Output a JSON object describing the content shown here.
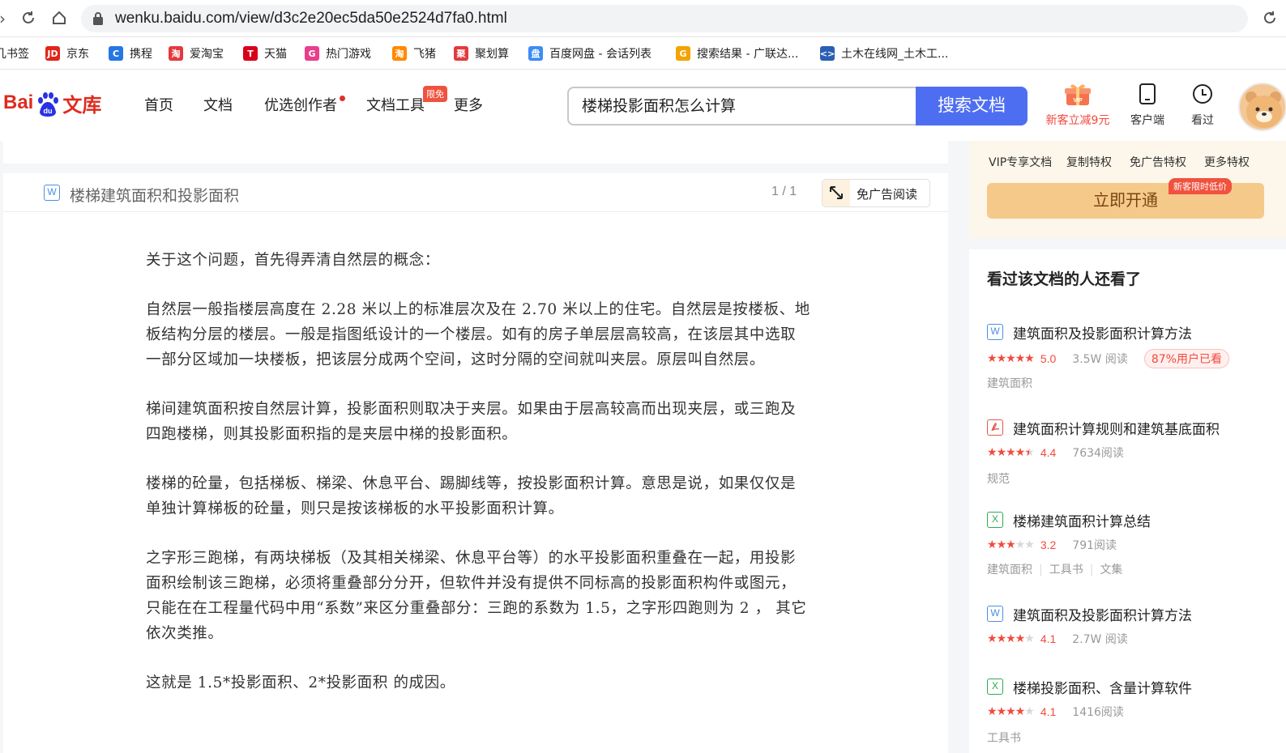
{
  "browser": {
    "url": "wenku.baidu.com/view/d3c2e20ec5da50e2524d7fa0.html"
  },
  "bookmarks": [
    {
      "label": "几书签",
      "icon": "bookmark-icon",
      "color": "#888888"
    },
    {
      "label": "京东",
      "icon": "jd-icon",
      "color": "#e1251b",
      "glyph": "JD"
    },
    {
      "label": "携程",
      "icon": "ctrip-icon",
      "color": "#2577e3",
      "glyph": "C"
    },
    {
      "label": "爱淘宝",
      "icon": "aitaobao-icon",
      "color": "#e4393c",
      "glyph": "淘"
    },
    {
      "label": "天猫",
      "icon": "tmall-icon",
      "color": "#d8001b",
      "glyph": "T"
    },
    {
      "label": "热门游戏",
      "icon": "games-icon",
      "color": "#e83e8c",
      "glyph": "G"
    },
    {
      "label": "飞猪",
      "icon": "fliggy-icon",
      "color": "#ff8a00",
      "glyph": "淘"
    },
    {
      "label": "聚划算",
      "icon": "juhuasuan-icon",
      "color": "#e4393c",
      "glyph": "聚"
    },
    {
      "label": "百度网盘 - 会话列表",
      "icon": "baidu-netdisk-icon",
      "color": "#3b8cf5",
      "glyph": "盘"
    },
    {
      "label": "搜索结果 - 广联达...",
      "icon": "glodon-icon",
      "color": "#f4a300",
      "glyph": "G"
    },
    {
      "label": "土木在线网_土木工...",
      "icon": "tumu-icon",
      "color": "#2b5fb4",
      "glyph": "<>"
    }
  ],
  "header": {
    "logo_bai": "Bai",
    "logo_du": "du",
    "logo_wenku": "文库",
    "nav": [
      "首页",
      "文档",
      "优选创作者",
      "文档工具",
      "更多"
    ],
    "limit_badge": "限免",
    "search_value": "楼梯投影面积怎么计算",
    "search_button": "搜索文档",
    "vip_promo": "新客立减9元",
    "client": "客户端",
    "history": "看过",
    "vip_gift_label": "VIP"
  },
  "document": {
    "title": "楼梯建筑面积和投影面积",
    "page_indicator": "1 / 1",
    "noad_label": "免广告阅读",
    "paragraphs": [
      "关于这个问题，首先得弄清自然层的概念：",
      "自然层一般指楼层高度在 2.28 米以上的标准层次及在 2.70 米以上的住宅。自然层是按楼板、地板结构分层的楼层。一般是指图纸设计的一个楼层。如有的房子单层层高较高，在该层其中选取一部分区域加一块楼板，把该层分成两个空间，这时分隔的空间就叫夹层。原层叫自然层。",
      "梯间建筑面积按自然层计算，投影面积则取决于夹层。如果由于层高较高而出现夹层，或三跑及四跑楼梯，则其投影面积指的是夹层中梯的投影面积。",
      "楼梯的砼量，包括梯板、梯梁、休息平台、踢脚线等，按投影面积计算。意思是说，如果仅仅是单独计算梯板的砼量，则只是按该梯板的水平投影面积计算。",
      "之字形三跑梯，有两块梯板（及其相关梯梁、休息平台等）的水平投影面积重叠在一起，用投影面积绘制该三跑梯，必须将重叠部分分开，但软件并没有提供不同标高的投影面积构件或图元，只能在在工程量代码中用“系数”来区分重叠部分：三跑的系数为 1.5，之字形四跑则为 2 ， 其它依次类推。",
      "这就是  1.5*投影面积、2*投影面积  的成因。"
    ]
  },
  "vip": {
    "perks": [
      "VIP专享文档",
      "复制特权",
      "免广告特权",
      "更多特权"
    ],
    "button": "立即开通",
    "badge": "新客限时低价"
  },
  "recommend": {
    "heading": "看过该文档的人还看了",
    "items": [
      {
        "type": "W",
        "color": "#4a90e2",
        "title": "建筑面积及投影面积计算方法",
        "stars": 5,
        "score": "5.0",
        "reads": "3.5W 阅读",
        "pct": "87%用户已看",
        "tags": [
          "建筑面积"
        ]
      },
      {
        "type": "PDF",
        "color": "#e2574c",
        "title": "建筑面积计算规则和建筑基底面积",
        "stars": 4.5,
        "score": "4.4",
        "reads": "7634阅读",
        "pct": "",
        "tags": [
          "规范"
        ]
      },
      {
        "type": "X",
        "color": "#2eaa52",
        "title": "楼梯建筑面积计算总结",
        "stars": 3,
        "score": "3.2",
        "reads": "791阅读",
        "pct": "",
        "tags": [
          "建筑面积",
          "工具书",
          "文集"
        ]
      },
      {
        "type": "W",
        "color": "#4a90e2",
        "title": "建筑面积及投影面积计算方法",
        "stars": 4,
        "score": "4.1",
        "reads": "2.7W 阅读",
        "pct": "",
        "tags": []
      },
      {
        "type": "X",
        "color": "#2eaa52",
        "title": "楼梯投影面积、含量计算软件",
        "stars": 4,
        "score": "4.1",
        "reads": "1416阅读",
        "pct": "",
        "tags": [
          "工具书"
        ]
      }
    ]
  }
}
